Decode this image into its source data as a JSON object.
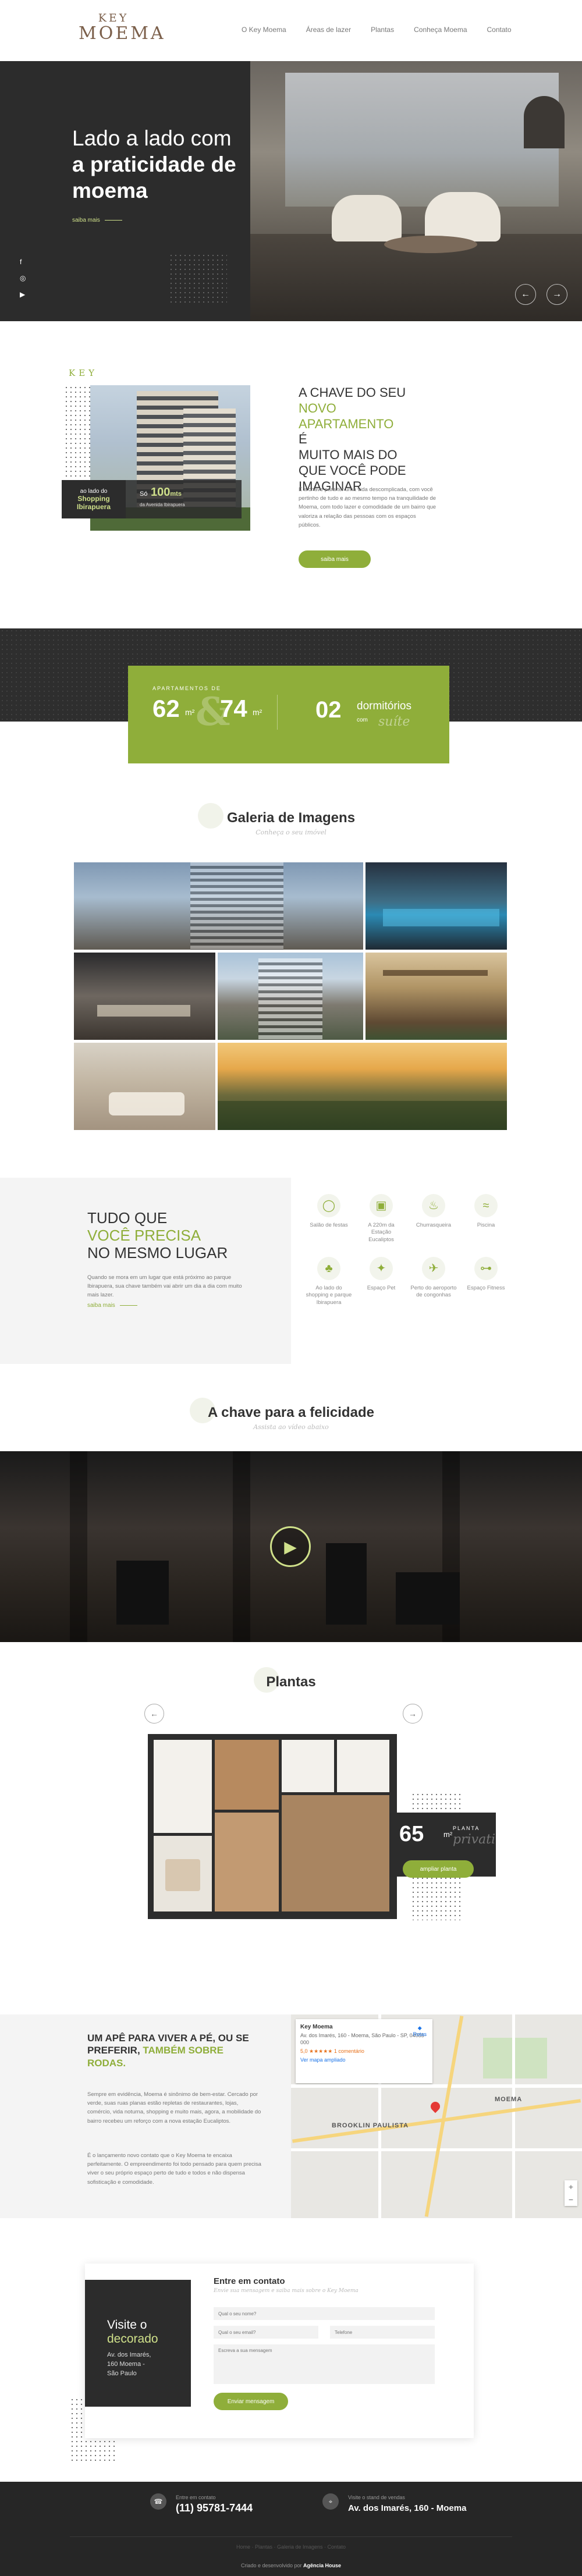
{
  "brand": {
    "line1": "KEY",
    "line2": "MOEMA"
  },
  "nav": {
    "items": [
      "O Key Moema",
      "Áreas de lazer",
      "Plantas",
      "Conheça Moema",
      "Contato"
    ]
  },
  "hero": {
    "title_line1": "Lado a lado com",
    "title_line2": "a praticidade de",
    "title_line3": "moema",
    "more_label": "saiba mais",
    "social": [
      "facebook-icon",
      "instagram-icon",
      "youtube-icon"
    ],
    "prev_icon": "←",
    "next_icon": "→"
  },
  "about": {
    "key_side": "KEY",
    "badge_left_small": "ao lado do",
    "badge_left_big": "Shopping Ibirapuera",
    "badge_right_num": "100",
    "badge_right_prefix": "Só",
    "badge_right_unit": "mts",
    "badge_right_sub": "da Avenida Ibirapuera",
    "title_l1": "A CHAVE DO SEU",
    "title_l2": "NOVO",
    "title_l3": "APARTAMENTO",
    "title_l3b": " É",
    "title_l4": "MUITO MAIS DO",
    "title_l5": "QUE VOCÊ PODE",
    "title_l6": "IMAGINAR",
    "text": "É a chave para ter uma vida descomplicada, com você pertinho de tudo e ao mesmo tempo na tranquilidade de Moema, com todo lazer e comodidade de um bairro que valoriza a relação das pessoas com os espaços públicos.",
    "button": "saiba mais"
  },
  "stats": {
    "kicker": "APARTAMENTOS DE",
    "area1": "62",
    "area2": "74",
    "unit": "m²",
    "amp": "&",
    "rooms": "02",
    "rooms_label": "dormitórios",
    "with": "com",
    "suite": "suíte"
  },
  "gallery": {
    "title": "Galeria de Imagens",
    "subtitle": "Conheça o seu imóvel"
  },
  "amenities": {
    "title_l1": "TUDO QUE",
    "title_l2": "VOCÊ PRECISA",
    "title_l3": "NO MESMO LUGAR",
    "text": "Quando se mora em um lugar que está próximo ao parque Ibirapuera, sua chave também vai abrir um dia a dia com muito mais lazer.",
    "more_label": "saiba mais",
    "items": [
      {
        "label": "Salão de festas",
        "icon": "balloon-icon"
      },
      {
        "label": "A 220m da Estação Eucaliptos",
        "icon": "train-icon"
      },
      {
        "label": "Churrasqueira",
        "icon": "grill-icon"
      },
      {
        "label": "Piscina",
        "icon": "pool-icon"
      },
      {
        "label": "Ao lado do shopping e parque Ibirapuera",
        "icon": "tree-icon"
      },
      {
        "label": "Espaço Pet",
        "icon": "pet-icon"
      },
      {
        "label": "Perto do aeroporto de congonhas",
        "icon": "plane-icon"
      },
      {
        "label": "Espaço Fitness",
        "icon": "dumbbell-icon"
      }
    ]
  },
  "video": {
    "title": "A chave para a felicidade",
    "subtitle": "Assista ao vídeo abaixo",
    "play_icon": "▶"
  },
  "plans": {
    "title": "Plantas",
    "area": "65",
    "unit": "m²",
    "label_top": "PLANTA",
    "label_script": "privativa",
    "button": "ampliar planta"
  },
  "location": {
    "title_a": "UM APÊ PARA VIVER A PÉ, OU SE PREFERIR, ",
    "title_b": "TAMBÉM SOBRE RODAS.",
    "p1": "Sempre em evidência, Moema é sinônimo de bem-estar. Cercado por verde, suas ruas planas estão repletas de restaurantes, lojas, comércio, vida noturna, shopping e muito mais, agora, a mobilidade do bairro recebeu um reforço com a nova estação Eucaliptos.",
    "p2": "É o lançamento novo contato que o Key Moema te encaixa perfeitamente. O empreendimento foi todo pensado para quem precisa viver o seu próprio espaço perto de tudo e todos e não dispensa sofisticação e comodidade.",
    "map_place": "Key Moema",
    "map_address": "Av. dos Imarés, 160 - Moema, São Paulo - SP, 04085-000",
    "map_rating": "5,0 ★★★★★ 1 comentário",
    "map_link": "Ver mapa ampliado",
    "map_directions": "Rotas",
    "map_areas": [
      "BROOKLIN PAULISTA",
      "MOEMA"
    ],
    "zoom_in": "+",
    "zoom_out": "−"
  },
  "contact": {
    "visit_l1": "Visite o",
    "visit_l2": "decorado",
    "visit_addr1": "Av. dos Imarés,",
    "visit_addr2": "160 Moema -",
    "visit_addr3": "São Paulo",
    "title": "Entre em contato",
    "subtitle": "Envie sua mensagem e saiba mais sobre o Key Moema",
    "name_ph": "Qual o seu nome?",
    "email_ph": "Qual o seu email?",
    "phone_ph": "Telefone",
    "msg_ph": "Escreva a sua mensagem",
    "button": "Enviar mensagem"
  },
  "footer": {
    "call_small": "Entre em contato",
    "phone": "(11) 95781-7444",
    "visit_small": "Visite o stand de vendas",
    "address": "Av. dos Imarés, 160 - Moema",
    "links": "Home · Plantas · Galeria de Imagens · Contato",
    "credit_pre": "Criado e desenvolvido por ",
    "credit_agency": "Agência House",
    "phone_icon": "☎",
    "pin_icon": "⌖"
  }
}
